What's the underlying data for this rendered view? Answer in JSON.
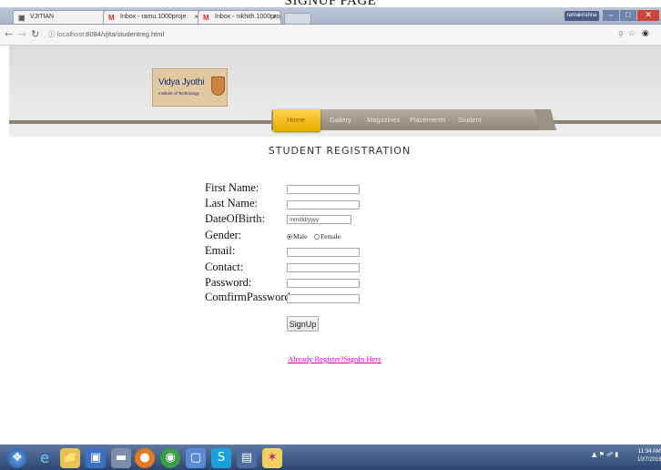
{
  "caption": "SIGNUP PAGE",
  "browser": {
    "tabs": [
      {
        "icon": "▣",
        "label": "VJITIAN",
        "close": "×"
      },
      {
        "icon": "M",
        "label": "Inbox - ramu.1000proje",
        "close": "×"
      },
      {
        "icon": "M",
        "label": "Inbox - nikhith.1000proj",
        "close": "×"
      }
    ],
    "user": "ramakrishna",
    "url_host": "localhost",
    "url_rest": ":8084/vjita/studentreg.html",
    "tab_icon_color": "#d93025"
  },
  "site": {
    "logo_name": "Vidya Jyothi",
    "logo_sub": "Institute of Technology",
    "nav": [
      "Home",
      "Gallery",
      "Magazines",
      "Placements",
      "Student"
    ]
  },
  "form": {
    "title": "STUDENT REGISTRATION",
    "labels": {
      "first_name": "First Name:",
      "last_name": "Last Name:",
      "dob": "DateOfBirth:",
      "gender": "Gender:",
      "email": "Email:",
      "contact": "Contact:",
      "password": "Password:",
      "confirm": "ComfirmPassword:"
    },
    "dob_placeholder": "mm/dd/yyyy",
    "gender_options": [
      "Male",
      "Female"
    ],
    "gender_selected": "Male",
    "submit_label": "SignUp",
    "signin_link": "Already Register?SignIn Here"
  },
  "taskbar": {
    "time": "11:34 AM",
    "date": "10/7/2016"
  }
}
